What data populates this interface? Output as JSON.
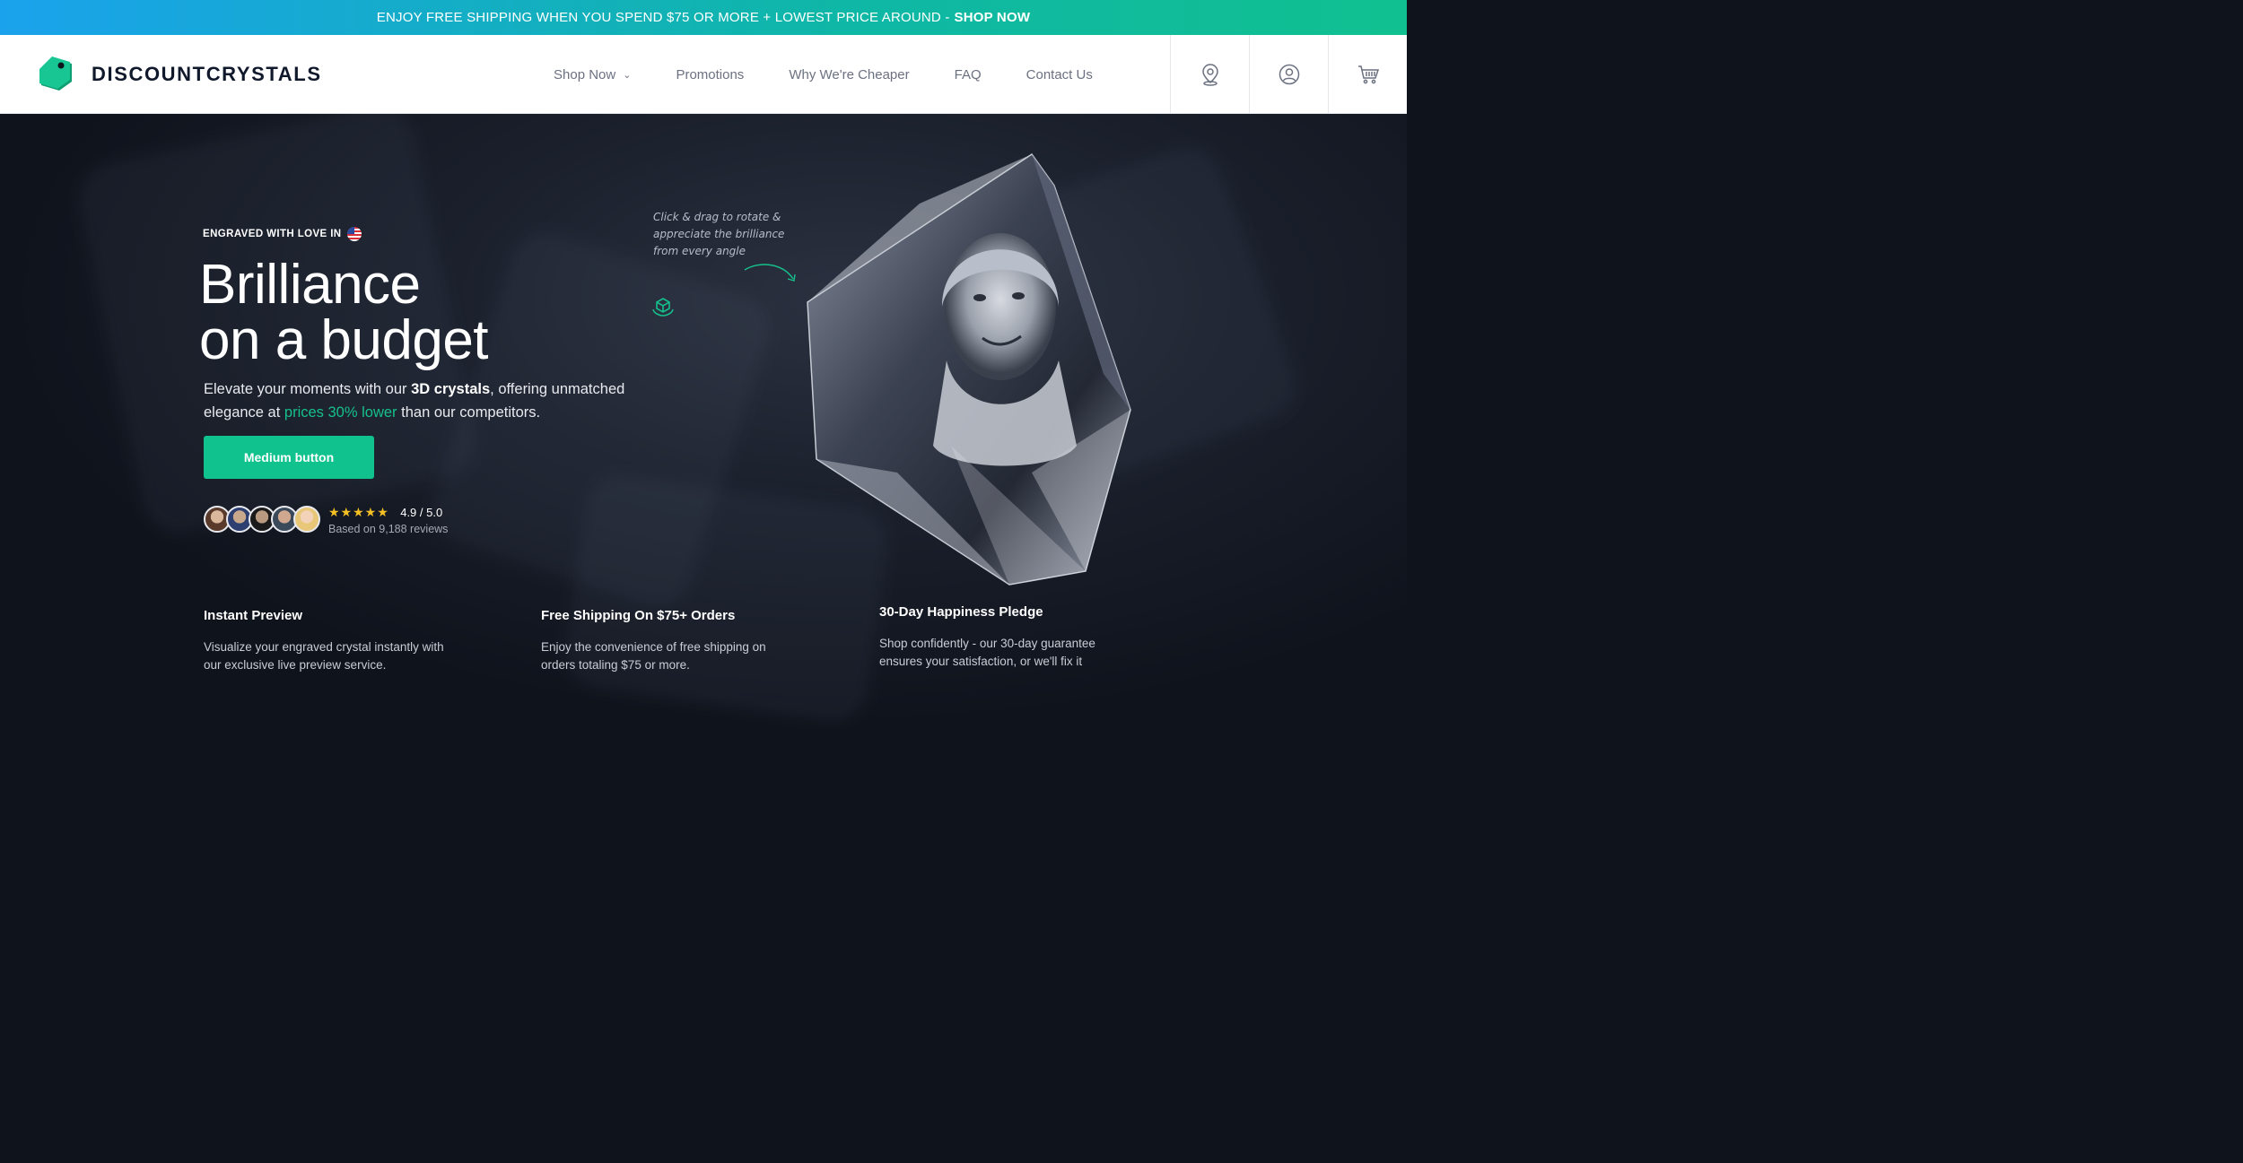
{
  "promo": {
    "text": "ENJOY FREE SHIPPING WHEN YOU SPEND $75 OR MORE + LOWEST PRICE AROUND -",
    "link": "SHOP NOW"
  },
  "brand": {
    "name": "DISCOUNTCRYSTALS",
    "accent": "#10c28e"
  },
  "nav": {
    "items": [
      {
        "label": "Shop Now",
        "dropdown": true
      },
      {
        "label": "Promotions"
      },
      {
        "label": "Why We're Cheaper"
      },
      {
        "label": "FAQ"
      },
      {
        "label": "Contact Us"
      }
    ],
    "icons": [
      "location-pin-icon",
      "user-account-icon",
      "shopping-cart-icon"
    ]
  },
  "hero": {
    "eyebrow": "ENGRAVED WITH LOVE IN",
    "headline_line1": "Brilliance",
    "headline_line2": "on a budget",
    "sub_part1": "Elevate your moments with our ",
    "sub_bold": "3D crystals",
    "sub_part2": ", offering unmatched elegance at ",
    "sub_highlight": "prices 30% lower",
    "sub_part3": " than our competitors.",
    "cta": "Medium button",
    "rating_score": "4.9 / 5.0",
    "rating_stars": "★★★★★",
    "rating_reviews": "Based on 9,188 reviews",
    "rotate_note": "Click & drag to rotate & appreciate the brilliance from every angle"
  },
  "features": [
    {
      "title": "Instant Preview",
      "text": "Visualize your engraved crystal instantly with our exclusive live preview service."
    },
    {
      "title": "Free Shipping On $75+ Orders",
      "text": "Enjoy the convenience of free shipping on orders totaling $75 or more."
    },
    {
      "title": "30-Day Happiness Pledge",
      "text": "Shop confidently - our 30-day guarantee ensures your satisfaction, or we'll fix it"
    }
  ]
}
